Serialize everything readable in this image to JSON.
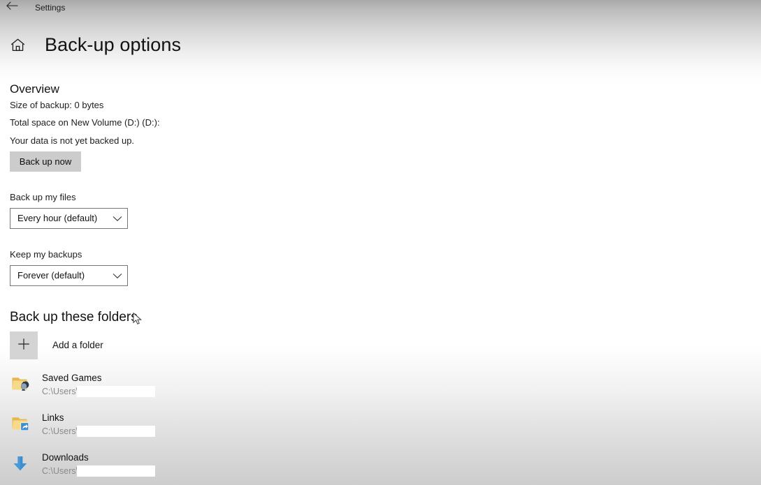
{
  "titlebar": {
    "back_icon": "back-arrow-icon",
    "title": "Settings"
  },
  "header": {
    "home_icon": "home-icon",
    "title": "Back-up options"
  },
  "overview": {
    "heading": "Overview",
    "size_of_backup": "Size of backup: 0 bytes",
    "total_space": "Total space on New Volume (D:) (D:):",
    "status": "Your data is not yet backed up.",
    "backup_now_label": "Back up now"
  },
  "settings": {
    "backup_files": {
      "label": "Back up my files",
      "value": "Every hour (default)",
      "chevron_icon": "chevron-down-icon"
    },
    "keep_backups": {
      "label": "Keep my backups",
      "value": "Forever (default)",
      "chevron_icon": "chevron-down-icon"
    }
  },
  "folders_section": {
    "heading": "Back up these folders",
    "add_folder_label": "Add a folder",
    "add_folder_icon": "plus-icon",
    "items": [
      {
        "name": "Saved Games",
        "path": "C:\\Users\\",
        "icon": "saved-games-folder-icon"
      },
      {
        "name": "Links",
        "path": "C:\\Users\\",
        "icon": "links-shortcut-folder-icon"
      },
      {
        "name": "Downloads",
        "path": "C:\\Users\\",
        "icon": "downloads-arrow-icon"
      }
    ]
  },
  "cursor": {
    "icon": "mouse-pointer-icon"
  },
  "colors": {
    "accent_blue": "#2f7dd1",
    "folder_yellow": "#f3cf71",
    "button_gray": "#cccccc",
    "add_button_gray": "#d4d4d4"
  }
}
